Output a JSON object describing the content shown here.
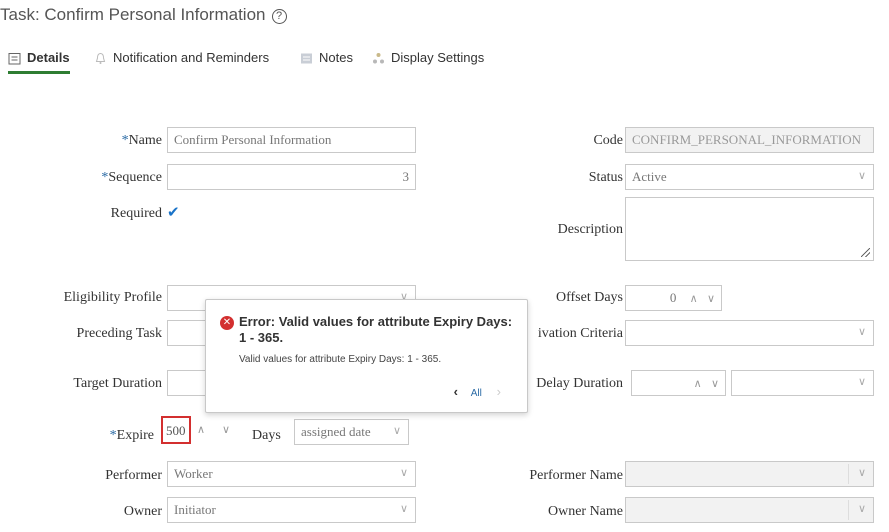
{
  "header": {
    "title": "Task: Confirm Personal Information"
  },
  "tabs": [
    {
      "label": "Details",
      "icon": "details-icon",
      "active": true
    },
    {
      "label": "Notification and Reminders",
      "icon": "bell-icon",
      "active": false
    },
    {
      "label": "Notes",
      "icon": "notes-icon",
      "active": false
    },
    {
      "label": "Display Settings",
      "icon": "display-settings-icon",
      "active": false
    }
  ],
  "form": {
    "name": {
      "label": "Name",
      "value": "Confirm Personal Information"
    },
    "sequence": {
      "label": "Sequence",
      "value": "3"
    },
    "required": {
      "label": "Required",
      "checked": true
    },
    "eligibility_profile": {
      "label": "Eligibility Profile",
      "value": ""
    },
    "preceding_task": {
      "label": "Preceding Task",
      "value": ""
    },
    "target_duration": {
      "label": "Target Duration",
      "value": ""
    },
    "expire": {
      "label": "Expire",
      "value": "500",
      "unit_label": "Days",
      "basis": "assigned date"
    },
    "performer": {
      "label": "Performer",
      "value": "Worker"
    },
    "owner": {
      "label": "Owner",
      "value": "Initiator"
    },
    "code": {
      "label": "Code",
      "value": "CONFIRM_PERSONAL_INFORMATION"
    },
    "status": {
      "label": "Status",
      "value": "Active"
    },
    "description": {
      "label": "Description",
      "value": ""
    },
    "offset_days": {
      "label": "Offset Days",
      "value": "0"
    },
    "activation_criteria": {
      "label": "ivation Criteria",
      "value": ""
    },
    "delay_duration": {
      "label": "Delay Duration",
      "value": "",
      "unit": ""
    },
    "performer_name": {
      "label": "Performer Name",
      "value": ""
    },
    "owner_name": {
      "label": "Owner Name",
      "value": ""
    }
  },
  "error_popup": {
    "title": "Error: Valid values for attribute Expiry Days: 1 - 365.",
    "detail": "Valid values for attribute Expiry Days: 1 - 365.",
    "nav_label": "All"
  },
  "colors": {
    "accent": "#2e7d32",
    "error": "#d32f2f",
    "link": "#2a6aa5",
    "checkbox": "#1a73c8"
  }
}
